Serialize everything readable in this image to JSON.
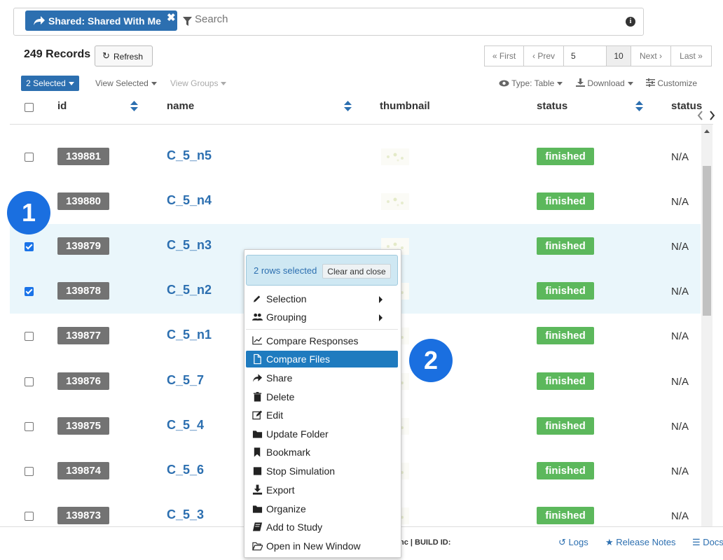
{
  "filter": {
    "chip_prefix": "Shared:",
    "chip_value": "Shared With Me",
    "remove_glyph": "✖",
    "search_placeholder": "Search",
    "info_glyph": "i"
  },
  "records": {
    "count_label": "249 Records",
    "refresh_label": "Refresh"
  },
  "pager": {
    "first": "« First",
    "prev": "‹ Prev",
    "page_value": "5",
    "page_size": "10",
    "next": "Next ›",
    "last": "Last »"
  },
  "toolbar": {
    "selected_label": "2 Selected",
    "view_selected": "View Selected",
    "view_groups": "View Groups",
    "type_label": "Type: Table",
    "download_label": "Download",
    "customize_label": "Customize"
  },
  "columns": {
    "id": "id",
    "name": "name",
    "thumbnail": "thumbnail",
    "status": "status",
    "status2": "status"
  },
  "rows": [
    {
      "id": "139881",
      "name": "C_5_n5",
      "status": "finished",
      "extra": "N/A",
      "checked": false
    },
    {
      "id": "139880",
      "name": "C_5_n4",
      "status": "finished",
      "extra": "N/A",
      "checked": false
    },
    {
      "id": "139879",
      "name": "C_5_n3",
      "status": "finished",
      "extra": "N/A",
      "checked": true
    },
    {
      "id": "139878",
      "name": "C_5_n2",
      "status": "finished",
      "extra": "N/A",
      "checked": true
    },
    {
      "id": "139877",
      "name": "C_5_n1",
      "status": "finished",
      "extra": "N/A",
      "checked": false
    },
    {
      "id": "139876",
      "name": "C_5_7",
      "status": "finished",
      "extra": "N/A",
      "checked": false
    },
    {
      "id": "139875",
      "name": "C_5_4",
      "status": "finished",
      "extra": "N/A",
      "checked": false
    },
    {
      "id": "139874",
      "name": "C_5_6",
      "status": "finished",
      "extra": "N/A",
      "checked": false
    },
    {
      "id": "139873",
      "name": "C_5_3",
      "status": "finished",
      "extra": "N/A",
      "checked": false
    }
  ],
  "context_menu": {
    "rows_selected": "2 rows selected",
    "clear_close": "Clear and close",
    "items": [
      {
        "label": "Selection",
        "icon": "pencil-icon"
      },
      {
        "label": "Grouping",
        "icon": "users-icon"
      },
      {
        "label": "Compare Responses",
        "icon": "line-chart-icon"
      },
      {
        "label": "Compare Files",
        "icon": "file-icon"
      },
      {
        "label": "Share",
        "icon": "share-icon"
      },
      {
        "label": "Delete",
        "icon": "trash-icon"
      },
      {
        "label": "Edit",
        "icon": "edit-icon"
      },
      {
        "label": "Update Folder",
        "icon": "folder-icon"
      },
      {
        "label": "Bookmark",
        "icon": "bookmark-icon"
      },
      {
        "label": "Stop Simulation",
        "icon": "stop-icon"
      },
      {
        "label": "Export",
        "icon": "download-icon"
      },
      {
        "label": "Organize",
        "icon": "folder-icon"
      },
      {
        "label": "Add to Study",
        "icon": "book-icon"
      },
      {
        "label": "Open in New Window",
        "icon": "folder-open-icon"
      }
    ]
  },
  "footer": {
    "build_text": "nc | BUILD ID:",
    "logs": "Logs",
    "release_notes": "Release Notes",
    "docs": "Docs"
  },
  "markers": {
    "one": "1",
    "two": "2"
  },
  "colors": {
    "primary": "#2c6fb0",
    "success": "#5cb85c",
    "id_badge": "#737373",
    "selected_row": "#eaf6fb",
    "highlight": "#1f7bbf",
    "marker": "#1a6fe0"
  }
}
